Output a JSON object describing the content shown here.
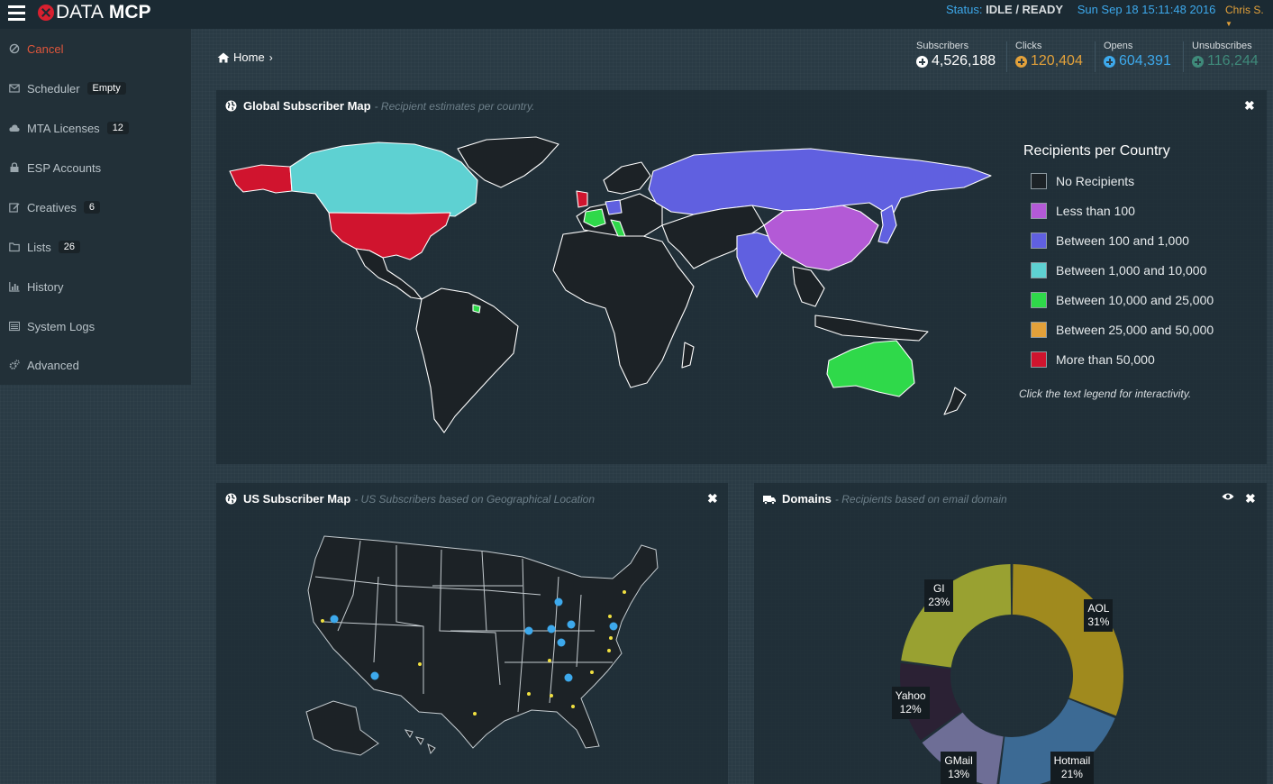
{
  "app": {
    "brand_light": "DATA",
    "brand_bold": "MCP"
  },
  "topbar": {
    "status_label": "Status:",
    "status_value": "IDLE / READY",
    "datetime": "Sun Sep 18 15:11:48 2016",
    "user": "Chris S."
  },
  "sidebar": {
    "items": [
      {
        "label": "Cancel",
        "icon": "ban-icon"
      },
      {
        "label": "Scheduler",
        "badge": "Empty",
        "icon": "envelope-icon"
      },
      {
        "label": "MTA Licenses",
        "badge": "12",
        "icon": "cloud-icon"
      },
      {
        "label": "ESP Accounts",
        "icon": "lock-icon"
      },
      {
        "label": "Creatives",
        "badge": "6",
        "icon": "edit-icon"
      },
      {
        "label": "Lists",
        "badge": "26",
        "icon": "folder-icon"
      },
      {
        "label": "History",
        "icon": "bar-chart-icon"
      },
      {
        "label": "System Logs",
        "icon": "list-icon"
      },
      {
        "label": "Advanced",
        "icon": "cogs-icon"
      }
    ]
  },
  "breadcrumb": {
    "home": "Home"
  },
  "stats": [
    {
      "label": "Subscribers",
      "value": "4,526,188",
      "color": "#ffffff"
    },
    {
      "label": "Clicks",
      "value": "120,404",
      "color": "#e3a13a"
    },
    {
      "label": "Opens",
      "value": "604,391",
      "color": "#3da9ec"
    },
    {
      "label": "Unsubscribes",
      "value": "116,244",
      "color": "#3f8a7a"
    }
  ],
  "global_map": {
    "title": "Global Subscriber Map",
    "subtitle": "- Recipient estimates per country.",
    "legend_title": "Recipients per Country",
    "legend": [
      {
        "label": "No Recipients",
        "color": "#1c2226"
      },
      {
        "label": "Less than 100",
        "color": "#b35ad6"
      },
      {
        "label": "Between 100 and 1,000",
        "color": "#6060e0"
      },
      {
        "label": "Between 1,000 and 10,000",
        "color": "#5ed1d2"
      },
      {
        "label": "Between 10,000 and 25,000",
        "color": "#2fd94a"
      },
      {
        "label": "Between 25,000 and 50,000",
        "color": "#e3a13a"
      },
      {
        "label": "More than 50,000",
        "color": "#d0142e"
      }
    ],
    "note": "Click the text legend for interactivity."
  },
  "us_map": {
    "title": "US Subscriber Map",
    "subtitle": "- US Subscribers based on Geographical Location"
  },
  "domains": {
    "title": "Domains",
    "subtitle": "- Recipients based on email domain",
    "slices": [
      {
        "name": "AOL",
        "percent": 31,
        "label": "31%",
        "color": "#a08a1e"
      },
      {
        "name": "Hotmail",
        "percent": 21,
        "label": "21%",
        "color": "#3c6a94"
      },
      {
        "name": "GMail",
        "percent": 13,
        "label": "13%",
        "color": "#6e6e96"
      },
      {
        "name": "Yahoo",
        "percent": 12,
        "label": "12%",
        "color": "#2b2134"
      },
      {
        "name": "GI",
        "percent": 23,
        "label": "23%",
        "color": "#99a131"
      }
    ]
  }
}
